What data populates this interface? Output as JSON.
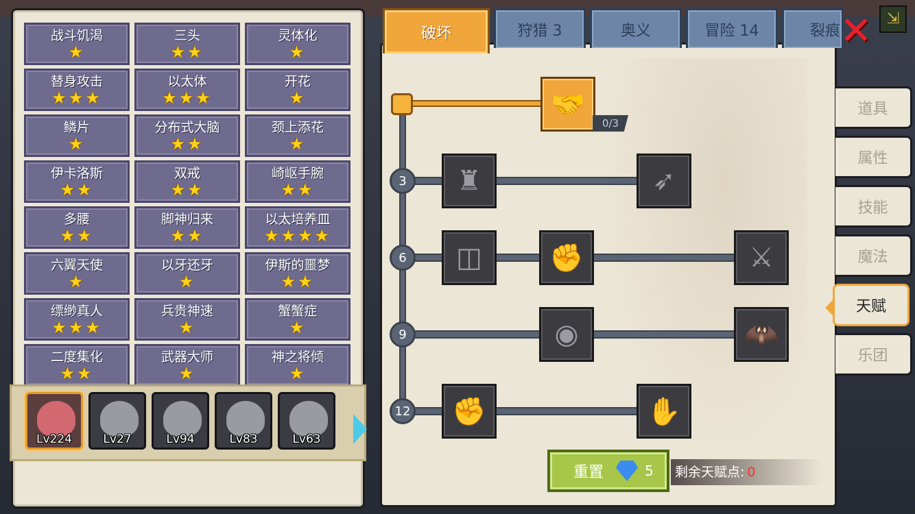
{
  "badges": [
    {
      "name": "战斗饥渴",
      "stars": "★"
    },
    {
      "name": "三头",
      "stars": "★★"
    },
    {
      "name": "灵体化",
      "stars": "★"
    },
    {
      "name": "替身攻击",
      "stars": "★★★"
    },
    {
      "name": "以太体",
      "stars": "★★★"
    },
    {
      "name": "开花",
      "stars": "★"
    },
    {
      "name": "鳞片",
      "stars": "★"
    },
    {
      "name": "分布式大脑",
      "stars": "★★"
    },
    {
      "name": "颈上添花",
      "stars": "★"
    },
    {
      "name": "伊卡洛斯",
      "stars": "★★"
    },
    {
      "name": "双戒",
      "stars": "★★"
    },
    {
      "name": "崎岖手腕",
      "stars": "★★"
    },
    {
      "name": "多腰",
      "stars": "★★"
    },
    {
      "name": "脚神归来",
      "stars": "★★"
    },
    {
      "name": "以太培养皿",
      "stars": "★★★★"
    },
    {
      "name": "六翼天使",
      "stars": "★"
    },
    {
      "name": "以牙还牙",
      "stars": "★"
    },
    {
      "name": "伊斯的噩梦",
      "stars": "★★"
    },
    {
      "name": "缥缈真人",
      "stars": "★★★"
    },
    {
      "name": "兵贵神速",
      "stars": "★"
    },
    {
      "name": "蟹蟹症",
      "stars": "★"
    },
    {
      "name": "二度集化",
      "stars": "★★"
    },
    {
      "name": "武器大师",
      "stars": "★"
    },
    {
      "name": "神之将倾",
      "stars": "★"
    }
  ],
  "heroes": [
    "Lv224",
    "Lv27",
    "Lv94",
    "Lv83",
    "Lv63"
  ],
  "tabs": [
    "破坏",
    "狩猎 3",
    "奥义",
    "冒险 14",
    "裂痕"
  ],
  "side_menu": [
    "道具",
    "属性",
    "技能",
    "魔法",
    "天赋",
    "乐团"
  ],
  "tree": {
    "top_count": "0/3",
    "levels": [
      "3",
      "6",
      "9",
      "12"
    ]
  },
  "reset": {
    "label": "重置",
    "gems": "5"
  },
  "remaining": {
    "label": "剩余天赋点:",
    "value": "0"
  },
  "colors": {
    "accent": "#f0a63a",
    "tab": "#6d86a8",
    "badge": "#6f6b8f",
    "reset": "#a7c64a"
  }
}
